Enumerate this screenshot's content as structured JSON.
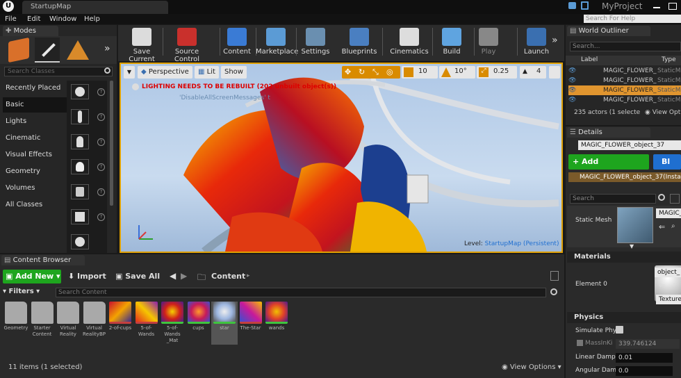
{
  "window": {
    "tab_title": "StartupMap",
    "project": "MyProject",
    "search_help": "Search For Help"
  },
  "menu": [
    "File",
    "Edit",
    "Window",
    "Help"
  ],
  "modes": {
    "tab": "Modes",
    "search_placeholder": "Search Classes",
    "items": [
      "Recently Placed",
      "Basic",
      "Lights",
      "Cinematic",
      "Visual Effects",
      "Geometry",
      "Volumes",
      "All Classes"
    ]
  },
  "toolbar": [
    {
      "label": "Save Current",
      "icon": "save-icon",
      "color": "#dcdcdc"
    },
    {
      "label": "Source Control",
      "icon": "source-control-icon",
      "color": "#c9302c"
    },
    {
      "label": "Content",
      "icon": "content-icon",
      "color": "#3a7bd5"
    },
    {
      "label": "Marketplace",
      "icon": "marketplace-icon",
      "color": "#5b9bd5"
    },
    {
      "label": "Settings",
      "icon": "settings-icon",
      "color": "#6a8fb0"
    },
    {
      "label": "Blueprints",
      "icon": "blueprints-icon",
      "color": "#4a7fc1"
    },
    {
      "label": "Cinematics",
      "icon": "cinematics-icon",
      "color": "#ddd"
    },
    {
      "label": "Build",
      "icon": "build-icon",
      "color": "#5fa4e0"
    },
    {
      "label": "Play",
      "icon": "play-icon",
      "color": "#888"
    },
    {
      "label": "Launch",
      "icon": "launch-icon",
      "color": "#3a6fb0"
    }
  ],
  "viewport": {
    "perspective": "Perspective",
    "lit": "Lit",
    "show": "Show",
    "warning": "LIGHTING NEEDS TO BE REBUILT (202 unbuilt object(s))",
    "subwarning": "'DisableAllScreenMessages' t",
    "grid_snap": "10",
    "rot_snap": "10°",
    "scale_snap": "0.25",
    "cam_speed": "4",
    "level_label": "Level:",
    "level_name": "StartupMap (Persistent)"
  },
  "outliner": {
    "tab": "World Outliner",
    "search_placeholder": "Search...",
    "col_label": "Label",
    "col_type": "Type",
    "rows": [
      {
        "label": "MAGIC_FLOWER_",
        "type": "StaticM"
      },
      {
        "label": "MAGIC_FLOWER_",
        "type": "StaticM"
      },
      {
        "label": "MAGIC_FLOWER_",
        "type": "StaticM"
      },
      {
        "label": "MAGIC_FLOWER_",
        "type": "StaticM"
      }
    ],
    "status": "235 actors (1 selecte",
    "view_options": "View Opt"
  },
  "details": {
    "tab": "Details",
    "name": "MAGIC_FLOWER_object_37",
    "add_component": "+ Add Component",
    "bp": "Bl",
    "instance": "MAGIC_FLOWER_object_37(Instan",
    "search_placeholder": "Search",
    "static_mesh_label": "Static Mesh",
    "static_mesh_value": "MAGIC_",
    "materials_header": "Materials",
    "element0": "Element 0",
    "material_value": "object_",
    "texture_label": "Texture",
    "physics_header": "Physics",
    "simulate": "Simulate Phy",
    "mass_label": "MassInKi",
    "mass_value": "339.746124",
    "linear_label": "Linear Damp",
    "linear_value": "0.01",
    "angular_label": "Angular Dam",
    "angular_value": "0.0"
  },
  "content_browser": {
    "tab": "Content Browser",
    "add_new": "Add New",
    "import": "Import",
    "save_all": "Save All",
    "path": "Content",
    "filters": "Filters",
    "search_placeholder": "Search Content",
    "items": [
      {
        "name": "Geometry",
        "kind": "folder"
      },
      {
        "name": "Starter Content",
        "kind": "folder"
      },
      {
        "name": "Virtual Reality",
        "kind": "folder"
      },
      {
        "name": "Virtual RealityBP",
        "kind": "folder"
      },
      {
        "name": "2-of-cups",
        "kind": "texture"
      },
      {
        "name": "5-of-Wands",
        "kind": "texture"
      },
      {
        "name": "5-of-Wands _Mat",
        "kind": "material"
      },
      {
        "name": "cups",
        "kind": "material"
      },
      {
        "name": "star",
        "kind": "material"
      },
      {
        "name": "The-Star",
        "kind": "texture"
      },
      {
        "name": "wands",
        "kind": "material"
      }
    ],
    "status": "11 items (1 selected)",
    "view_options": "View Options"
  }
}
